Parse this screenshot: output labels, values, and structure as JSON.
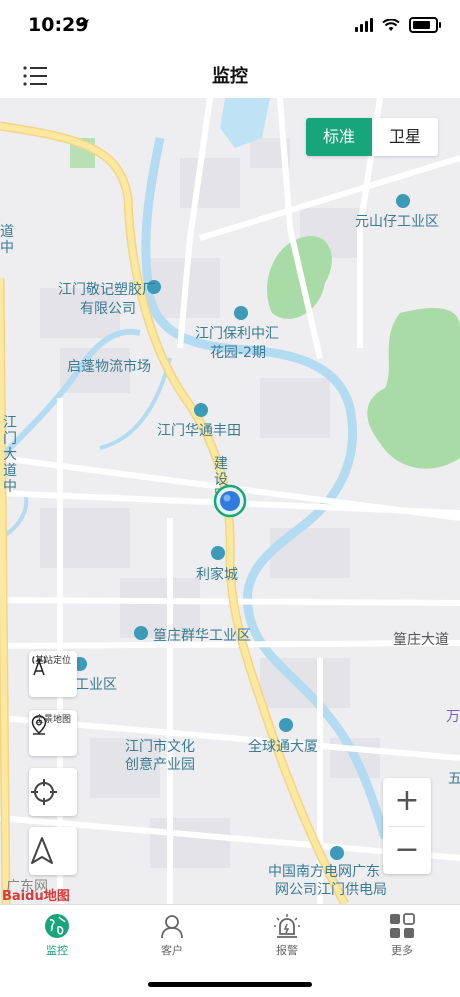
{
  "status": {
    "time": "10:29"
  },
  "header": {
    "title": "监控",
    "menu_icon": "list-menu-icon"
  },
  "map_type": {
    "standard": "标准",
    "satellite": "卫星",
    "active": "standard"
  },
  "map_labels": {
    "yuanshanzai": "元山仔工业区",
    "jingji_1": "江门敬记塑胶厂",
    "jingji_2": "有限公司",
    "baoli_1": "江门保利中汇",
    "baoli_2": "花园-2期",
    "qipeng": "启蓬物流市场",
    "huatong": "江门华通丰田",
    "lijiacheng": "利家城",
    "huangzhuang_qunhua": "篁庄群华工业区",
    "huangzhuang_road": "篁庄大道",
    "gongyequ": "工业区",
    "wenhua_1": "江门市文化",
    "wenhua_2": "创意产业园",
    "quanqiutong": "全球通大厦",
    "nanfang_1": "中国南方电网广东",
    "nanfang_2": "网公司江门供电局",
    "jianshe_road": "建设路",
    "jiangmen_dadao": "江门大道中",
    "dadao_top": "道中",
    "edge_wan": "万",
    "edge_wu": "五",
    "baidu": "Baidu地图",
    "guangdong_net": "广东网"
  },
  "controls": {
    "base_station": "基站定位",
    "panorama": "全景地图",
    "locate_icon": "crosshair-icon",
    "navigate_icon": "navigation-arrow-icon",
    "zoom_in": "+",
    "zoom_out": "−"
  },
  "tabs": [
    {
      "label": "监控",
      "icon": "globe-icon",
      "active": true
    },
    {
      "label": "客户",
      "icon": "user-icon",
      "active": false
    },
    {
      "label": "报警",
      "icon": "alarm-light-icon",
      "active": false
    },
    {
      "label": "更多",
      "icon": "grid-icon",
      "active": false
    }
  ],
  "colors": {
    "accent": "#19a57a",
    "inactive": "#666666",
    "water": "#bfe3f5",
    "park": "#9ed69e",
    "major_road": "#fde8a0"
  }
}
